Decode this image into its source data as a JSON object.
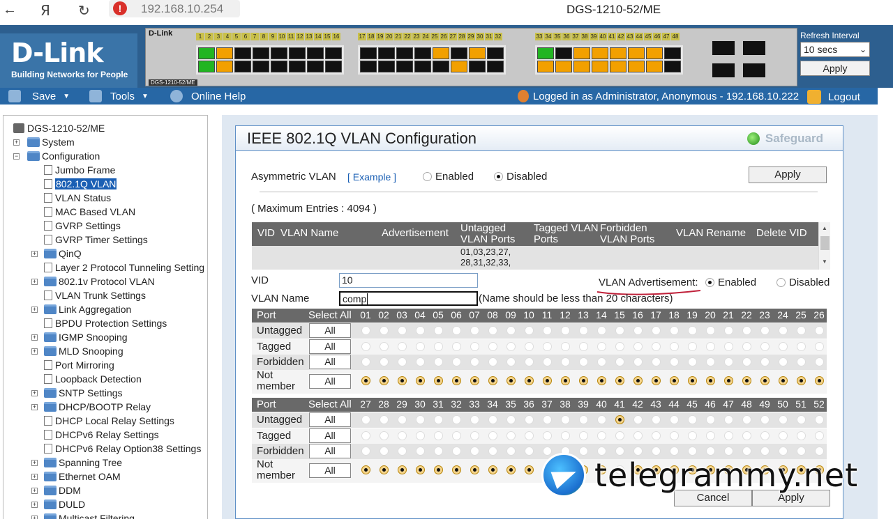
{
  "browser": {
    "back": "←",
    "yandex": "Я",
    "reload": "↻",
    "url": "192.168.10.254",
    "tab_title": "DGS-1210-52/ME"
  },
  "header": {
    "logo": "D-Link",
    "slogan": "Building Networks for People",
    "panel_label": "D-Link",
    "panel_model": "DGS-1210-52/ME",
    "refresh_label": "Refresh Interval",
    "refresh_value": "10 secs",
    "apply": "Apply"
  },
  "menu": {
    "save": "Save",
    "tools": "Tools",
    "online_help": "Online Help",
    "logged_in": "Logged in as Administrator, Anonymous - 192.168.10.222",
    "logout": "Logout"
  },
  "tree": [
    {
      "label": "DGS-1210-52/ME",
      "icon": "pc",
      "indent": 0
    },
    {
      "label": "System",
      "icon": "folder",
      "indent": 1,
      "exp": "+"
    },
    {
      "label": "Configuration",
      "icon": "folder",
      "indent": 1,
      "exp": "−"
    },
    {
      "label": "Jumbo Frame",
      "icon": "page",
      "indent": 2
    },
    {
      "label": "802.1Q VLAN",
      "icon": "page",
      "indent": 2,
      "selected": true
    },
    {
      "label": "VLAN Status",
      "icon": "page",
      "indent": 2
    },
    {
      "label": "MAC Based VLAN",
      "icon": "page",
      "indent": 2
    },
    {
      "label": "GVRP Settings",
      "icon": "page",
      "indent": 2
    },
    {
      "label": "GVRP Timer Settings",
      "icon": "page",
      "indent": 2
    },
    {
      "label": "QinQ",
      "icon": "folder",
      "indent": 2,
      "exp": "+"
    },
    {
      "label": "Layer 2 Protocol Tunneling Setting",
      "icon": "page",
      "indent": 2
    },
    {
      "label": "802.1v Protocol VLAN",
      "icon": "folder",
      "indent": 2,
      "exp": "+"
    },
    {
      "label": "VLAN Trunk Settings",
      "icon": "page",
      "indent": 2
    },
    {
      "label": "Link Aggregation",
      "icon": "folder",
      "indent": 2,
      "exp": "+"
    },
    {
      "label": "BPDU Protection Settings",
      "icon": "page",
      "indent": 2
    },
    {
      "label": "IGMP Snooping",
      "icon": "folder",
      "indent": 2,
      "exp": "+"
    },
    {
      "label": "MLD Snooping",
      "icon": "folder",
      "indent": 2,
      "exp": "+"
    },
    {
      "label": "Port Mirroring",
      "icon": "page",
      "indent": 2
    },
    {
      "label": "Loopback Detection",
      "icon": "page",
      "indent": 2
    },
    {
      "label": "SNTP Settings",
      "icon": "folder",
      "indent": 2,
      "exp": "+"
    },
    {
      "label": "DHCP/BOOTP Relay",
      "icon": "folder",
      "indent": 2,
      "exp": "+"
    },
    {
      "label": "DHCP Local Relay Settings",
      "icon": "page",
      "indent": 2
    },
    {
      "label": "DHCPv6 Relay Settings",
      "icon": "page",
      "indent": 2
    },
    {
      "label": "DHCPv6 Relay Option38 Settings",
      "icon": "page",
      "indent": 2
    },
    {
      "label": "Spanning Tree",
      "icon": "folder",
      "indent": 2,
      "exp": "+"
    },
    {
      "label": "Ethernet OAM",
      "icon": "folder",
      "indent": 2,
      "exp": "+"
    },
    {
      "label": "DDM",
      "icon": "folder",
      "indent": 2,
      "exp": "+"
    },
    {
      "label": "DULD",
      "icon": "folder",
      "indent": 2,
      "exp": "+"
    },
    {
      "label": "Multicast Filtering",
      "icon": "folder",
      "indent": 2,
      "exp": "+"
    }
  ],
  "main": {
    "title": "IEEE 802.1Q VLAN Configuration",
    "safeguard": "Safeguard",
    "asym_label": "Asymmetric VLAN",
    "example": "[ Example ]",
    "enabled": "Enabled",
    "disabled": "Disabled",
    "apply": "Apply",
    "max_entries": "( Maximum Entries : 4094 )",
    "table_headers": {
      "vid": "VID",
      "vlan_name": "VLAN Name",
      "advertisement": "Advertisement",
      "untagged_1": "Untagged",
      "untagged_2": "VLAN Ports",
      "tagged_1": "Tagged VLAN",
      "tagged_2": "Ports",
      "forbidden_1": "Forbidden",
      "forbidden_2": "VLAN Ports",
      "rename": "VLAN Rename",
      "delete": "Delete VID"
    },
    "untagged_cell_1": "01,03,23,27,",
    "untagged_cell_2": "28,31,32,33,",
    "vid_label": "VID",
    "vid_value": "10",
    "vlan_name_label": "VLAN Name",
    "vlan_name_value": "comp",
    "name_hint": "(Name should be less than 20 characters)",
    "adv_label": "VLAN Advertisement:",
    "adv_enabled": "Enabled",
    "adv_disabled": "Disabled",
    "port_head": "Port",
    "select_all": "Select All",
    "rows": [
      "Untagged",
      "Tagged",
      "Forbidden",
      "Not member"
    ],
    "row_not_1": "Not",
    "row_not_2": "member",
    "all": "All",
    "ports_a": [
      "01",
      "02",
      "03",
      "04",
      "05",
      "06",
      "07",
      "08",
      "09",
      "10",
      "11",
      "12",
      "13",
      "14",
      "15",
      "16",
      "17",
      "18",
      "19",
      "20",
      "21",
      "22",
      "23",
      "24",
      "25",
      "26"
    ],
    "ports_b": [
      "27",
      "28",
      "29",
      "30",
      "31",
      "32",
      "33",
      "34",
      "35",
      "36",
      "37",
      "38",
      "39",
      "40",
      "41",
      "42",
      "43",
      "44",
      "45",
      "46",
      "47",
      "48",
      "49",
      "50",
      "51",
      "52"
    ],
    "untagged_b_selected": [
      "41"
    ],
    "cancel": "Cancel",
    "apply_bottom": "Apply"
  },
  "watermark": "telegrammy.net"
}
